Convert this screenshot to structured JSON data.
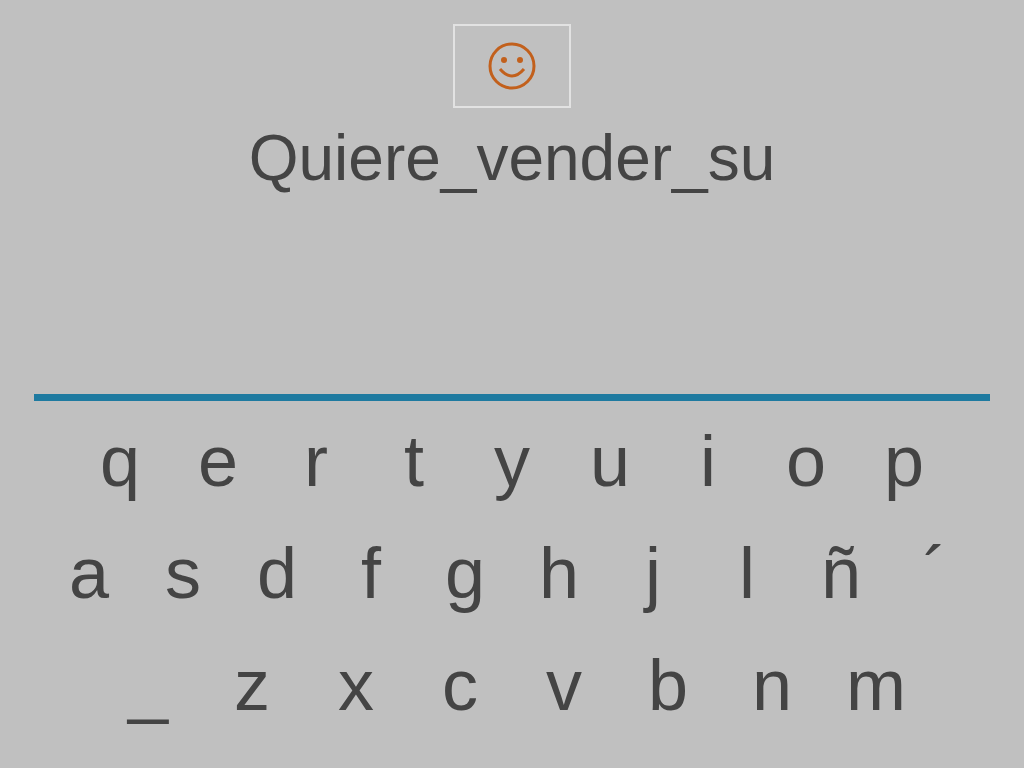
{
  "phrase": "Quiere_vender_su",
  "keyboard": {
    "rows": [
      [
        "q",
        "e",
        "r",
        "t",
        "y",
        "u",
        "i",
        "o",
        "p"
      ],
      [
        "a",
        "s",
        "d",
        "f",
        "g",
        "h",
        "j",
        "l",
        "ñ",
        "´"
      ],
      [
        "_",
        "z",
        "x",
        "c",
        "v",
        "b",
        "n",
        "m"
      ]
    ]
  }
}
